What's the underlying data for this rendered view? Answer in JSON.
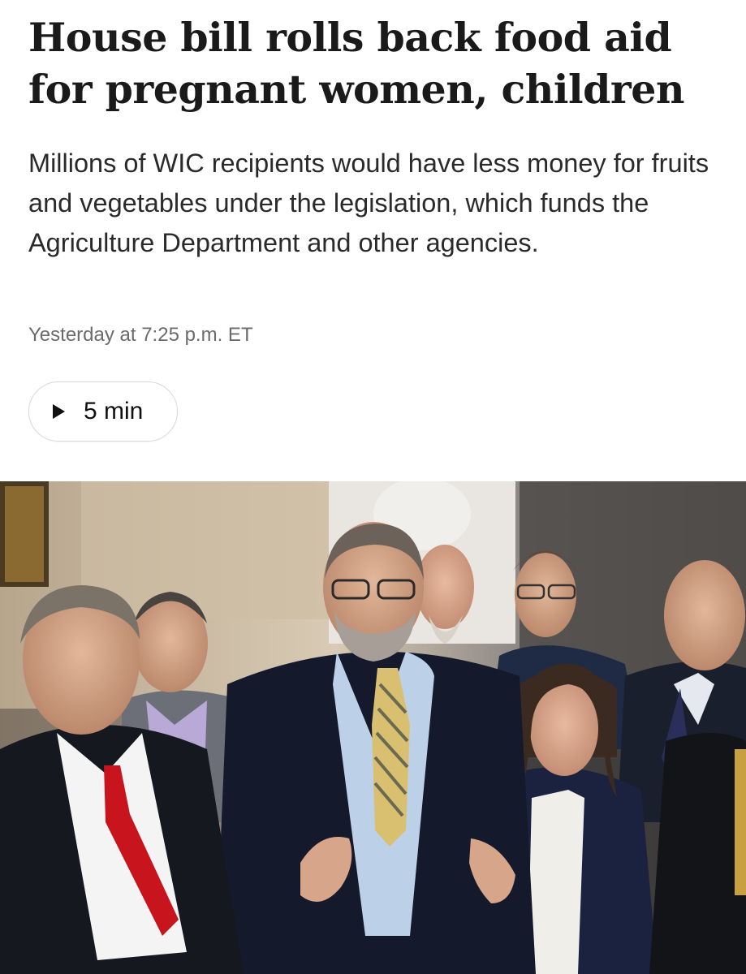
{
  "article": {
    "headline": "House bill rolls back food aid for pregnant women, children",
    "dek": "Millions of WIC recipients would have less money for fruits and vegetables under the legislation, which funds the Agriculture Department and other agencies.",
    "timestamp": "Yesterday at 7:25 p.m. ET"
  },
  "listen": {
    "icon": "play-icon",
    "label": "5 min"
  },
  "photo": {
    "description_icon": "news-photo"
  },
  "colors": {
    "headline": "#1a1a1a",
    "dek": "#2a2a2a",
    "timestamp": "#6b6b6b",
    "pill_border": "#d9d9d9"
  }
}
